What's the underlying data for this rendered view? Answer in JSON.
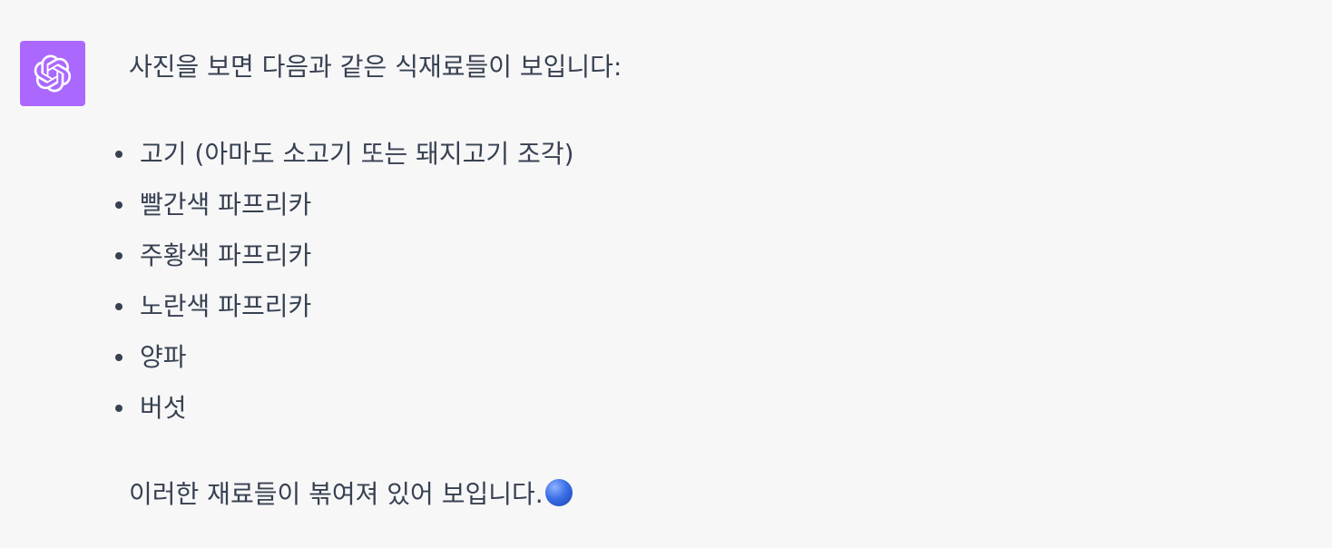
{
  "message": {
    "author_avatar_icon": "openai-logo-icon",
    "avatar_color": "#ab68ff",
    "intro": "사진을 보면 다음과 같은 식재료들이 보입니다:",
    "items": [
      "고기 (아마도 소고기 또는 돼지고기 조각)",
      "빨간색 파프리카",
      "주황색 파프리카",
      "노란색 파프리카",
      "양파",
      "버섯"
    ],
    "outro": "이러한 재료들이 볶여져 있어 보입니다."
  }
}
